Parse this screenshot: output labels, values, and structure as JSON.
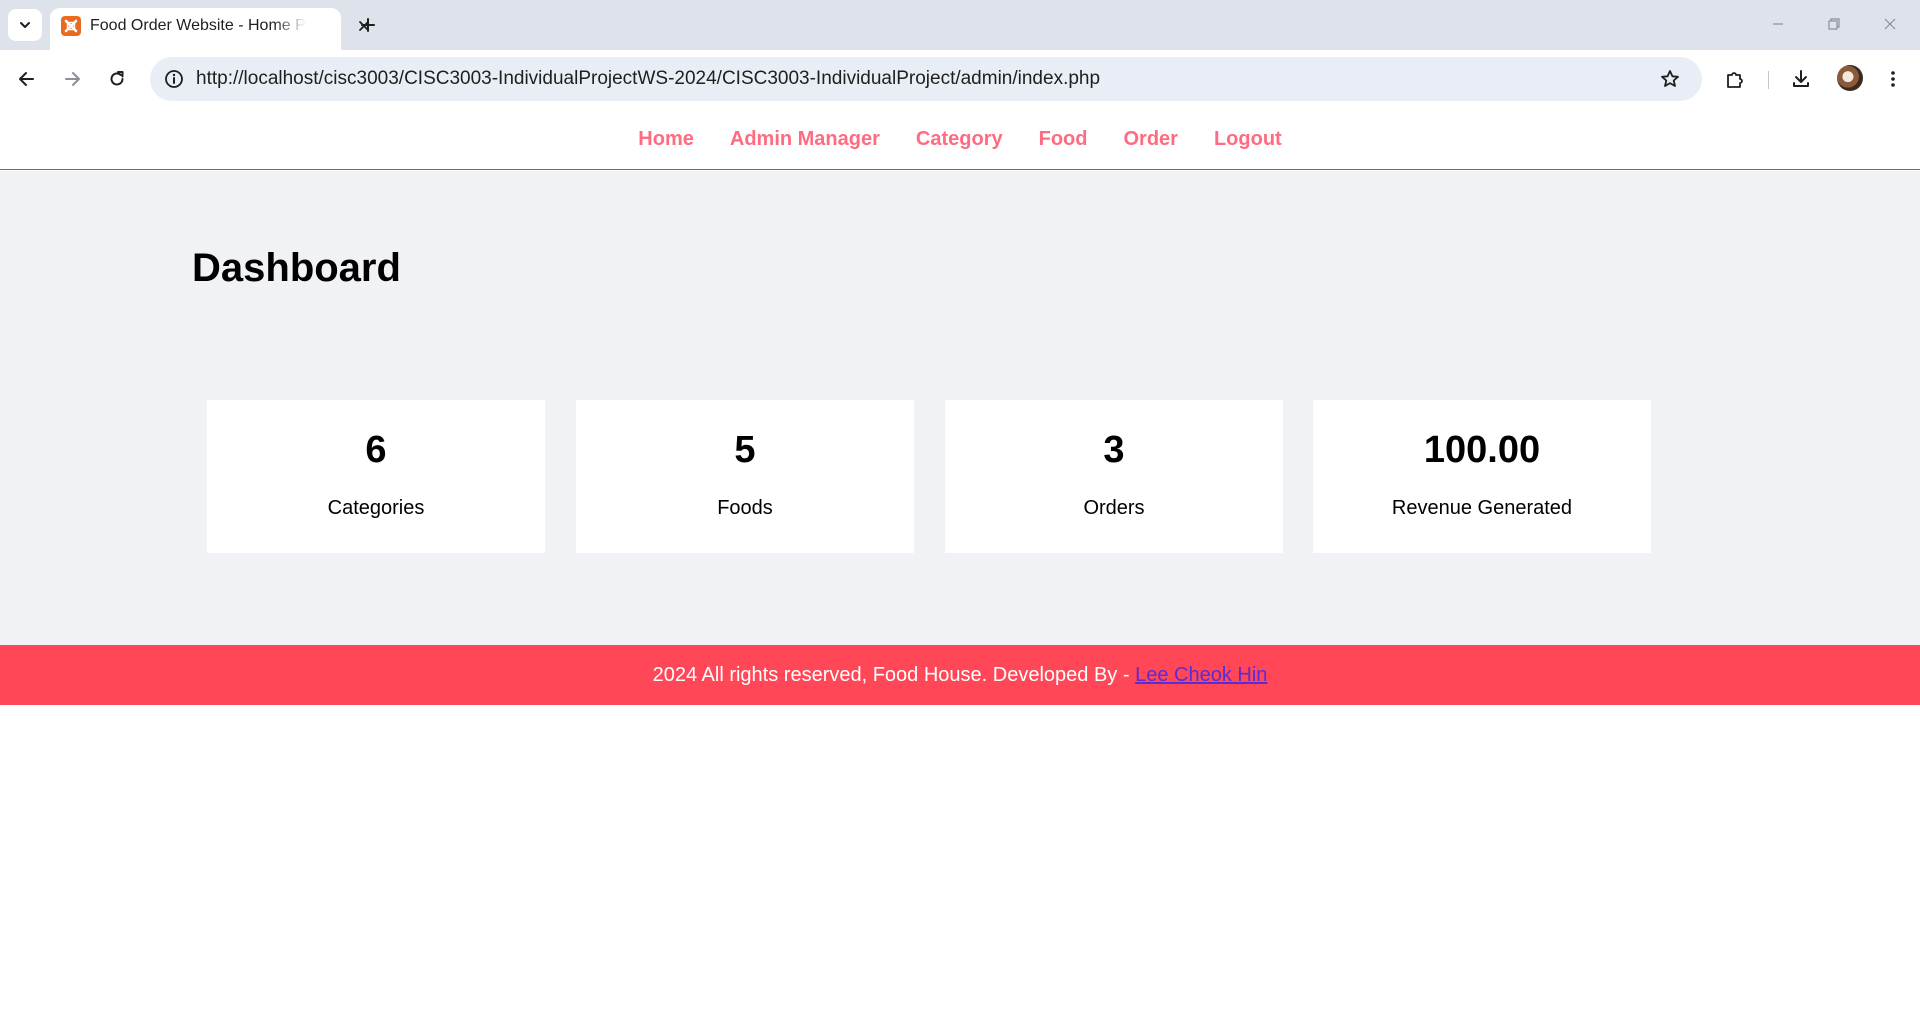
{
  "browser": {
    "tab_title": "Food Order Website - Home Page",
    "url": "http://localhost/cisc3003/CISC3003-IndividualProjectWS-2024/CISC3003-IndividualProject/admin/index.php"
  },
  "nav": {
    "items": [
      {
        "label": "Home"
      },
      {
        "label": "Admin Manager"
      },
      {
        "label": "Category"
      },
      {
        "label": "Food"
      },
      {
        "label": "Order"
      },
      {
        "label": "Logout"
      }
    ],
    "link_color": "#ff6b81"
  },
  "dashboard": {
    "title": "Dashboard",
    "cards": [
      {
        "value": "6",
        "label": "Categories"
      },
      {
        "value": "5",
        "label": "Foods"
      },
      {
        "value": "3",
        "label": "Orders"
      },
      {
        "value": "100.00",
        "label": "Revenue Generated"
      }
    ]
  },
  "footer": {
    "text": "2024 All rights reserved, Food House. Developed By - ",
    "link_label": "Lee Cheok Hin",
    "background": "#ff4757"
  },
  "icons": {
    "tab_menu": "chevron-down-icon",
    "favicon": "xampp-icon",
    "tab_close": "close-icon",
    "new_tab": "plus-icon",
    "back": "arrow-left-icon",
    "forward": "arrow-right-icon",
    "reload": "reload-icon",
    "site_info": "info-icon",
    "bookmark": "star-icon",
    "extensions": "puzzle-icon",
    "downloads": "download-icon",
    "menu": "kebab-menu-icon"
  }
}
